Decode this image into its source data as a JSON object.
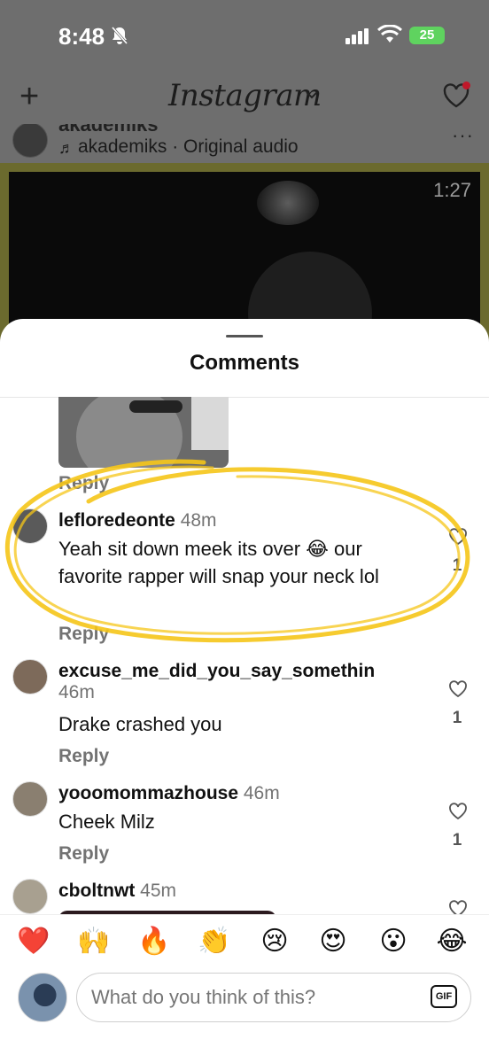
{
  "status_bar": {
    "time": "8:48",
    "battery": "25"
  },
  "header": {
    "logo": "Instagram"
  },
  "post": {
    "username_partial": "akademiks",
    "audio": "akademiks · Original audio",
    "duration": "1:27",
    "more": "···"
  },
  "sheet": {
    "title": "Comments",
    "reply_label": "Reply"
  },
  "comments": [
    {
      "username": "lefloredeonte",
      "time": "48m",
      "text": "Yeah sit down meek its over 😂 our favorite rapper will snap your neck lol",
      "likes": "1"
    },
    {
      "username": "excuse_me_did_you_say_somethin",
      "time": "46m",
      "text": "Drake crashed you",
      "likes": "1"
    },
    {
      "username": "yooomommazhouse",
      "time": "46m",
      "text": "Cheek Milz",
      "likes": "1"
    },
    {
      "username": "cboltnwt",
      "time": "45m"
    }
  ],
  "reactions": [
    "❤️",
    "🙌",
    "🔥",
    "👏",
    "😢",
    "😍",
    "😮",
    "😂"
  ],
  "composer": {
    "placeholder": "What do you think of this?",
    "gif_label": "GIF"
  },
  "colors": {
    "highlight": "#f5c518",
    "battery": "#5fd35f",
    "notification": "#c0182a"
  }
}
